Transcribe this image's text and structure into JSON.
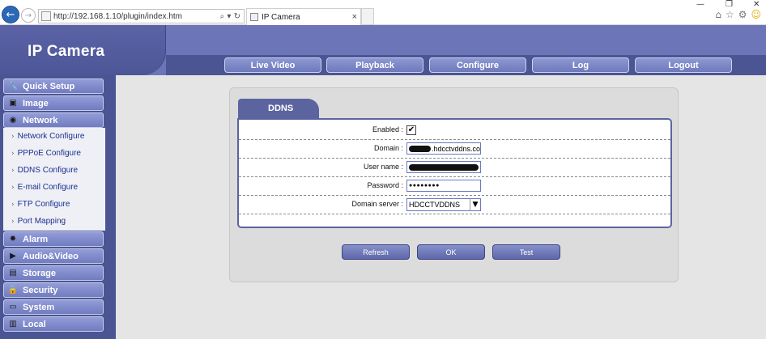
{
  "browser": {
    "url": "http://192.168.1.10/plugin/index.htm",
    "tab_title": "IP Camera",
    "addr_tools": "⌕ ▾ ↻",
    "tab_close": "×"
  },
  "app": {
    "title": "IP Camera"
  },
  "top_nav": [
    {
      "label": "Live Video"
    },
    {
      "label": "Playback"
    },
    {
      "label": "Configure"
    },
    {
      "label": "Log"
    },
    {
      "label": "Logout"
    }
  ],
  "sidebar": {
    "sections": [
      {
        "label": "Quick Setup",
        "icon": "wrench-icon"
      },
      {
        "label": "Image",
        "icon": "image-icon"
      },
      {
        "label": "Network",
        "icon": "network-icon"
      },
      {
        "label": "Alarm",
        "icon": "alarm-icon"
      },
      {
        "label": "Audio&Video",
        "icon": "video-camera-icon"
      },
      {
        "label": "Storage",
        "icon": "storage-icon"
      },
      {
        "label": "Security",
        "icon": "lock-icon"
      },
      {
        "label": "System",
        "icon": "system-icon"
      },
      {
        "label": "Local",
        "icon": "local-icon"
      }
    ],
    "network_items": [
      {
        "label": "Network Configure"
      },
      {
        "label": "PPPoE Configure"
      },
      {
        "label": "DDNS Configure"
      },
      {
        "label": "E-mail Configure"
      },
      {
        "label": "FTP Configure"
      },
      {
        "label": "Port Mapping"
      }
    ]
  },
  "ddns": {
    "tab_label": "DDNS",
    "fields": {
      "enabled_label": "Enabled :",
      "enabled_checked": true,
      "domain_label": "Domain :",
      "domain_value": ".hdcctvddns.co",
      "username_label": "User name :",
      "password_label": "Password :",
      "password_value": "●●●●●●●●",
      "server_label": "Domain server :",
      "server_value": "HDCCTVDDNS"
    },
    "buttons": {
      "refresh": "Refresh",
      "ok": "OK",
      "test": "Test"
    }
  }
}
